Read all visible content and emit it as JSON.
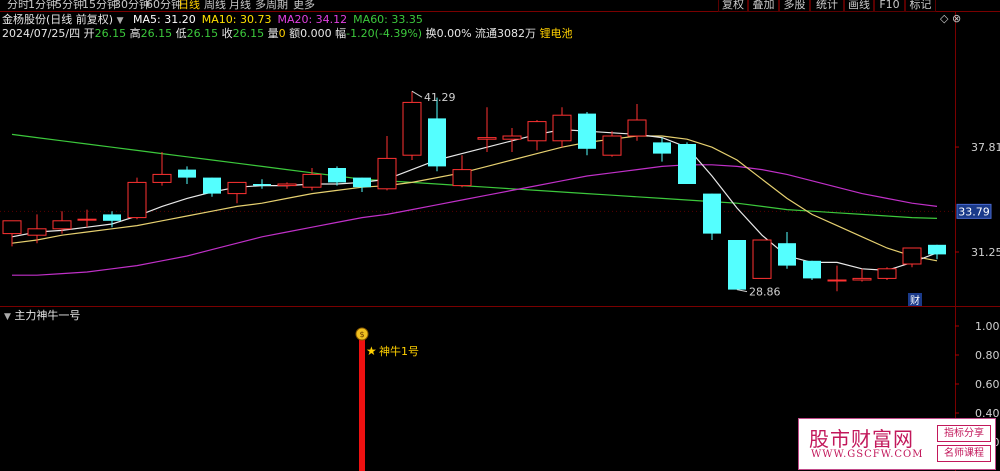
{
  "toolbar": {
    "periods": [
      "分时",
      "1分钟",
      "5分钟",
      "15分钟",
      "30分钟",
      "60分钟",
      "日线",
      "周线",
      "月线",
      "多周期",
      "更多"
    ],
    "selected_period": "日线",
    "right_buttons": [
      "复权",
      "叠加",
      "多股",
      "统计",
      "画线",
      "F10",
      "标记"
    ]
  },
  "header": {
    "stock": "金杨股份(日线 前复权)",
    "ma_items": [
      {
        "label": "MA5: 31.20",
        "color": "#ffffff"
      },
      {
        "label": "MA10: 30.73",
        "color": "#ffe000"
      },
      {
        "label": "MA20: 34.12",
        "color": "#e040e0"
      },
      {
        "label": "MA60: 33.35",
        "color": "#3cc83c"
      }
    ],
    "date": "2024/07/25/四",
    "open_label": "开",
    "open": "26.15",
    "high_label": "高",
    "high": "26.15",
    "low_label": "低",
    "low": "26.15",
    "close_label": "收",
    "close": "26.15",
    "vol_label": "量",
    "vol": "0",
    "amount_label": "额",
    "amount": "0.000",
    "chg_label": "幅",
    "chg": "-1.20(-4.39%)",
    "turnover": "换0.00%",
    "float_label": "流通",
    "float": "3082万",
    "concept": "锂电池"
  },
  "price_axis": [
    {
      "value": 37.81,
      "label": "37.81"
    },
    {
      "value": 31.25,
      "label": "31.25"
    }
  ],
  "current_price": {
    "value": 33.79,
    "label": "33.79"
  },
  "annotations": {
    "high_label": "41.29",
    "low_label": "28.86",
    "fin_badge": "财"
  },
  "indicator": {
    "name": "主力神牛一号",
    "signal_label": "神牛1号",
    "axis": [
      {
        "value": 1.0,
        "label": "1.00"
      },
      {
        "value": 0.8,
        "label": "0.80"
      },
      {
        "value": 0.6,
        "label": "0.60"
      },
      {
        "value": 0.4,
        "label": "0.40"
      },
      {
        "value": 0.2,
        "label": "0.20"
      }
    ],
    "signal_index": 14,
    "signal_value": 1.0
  },
  "watermark": {
    "main": "股市财富网",
    "url": "WWW.GSCFW.COM",
    "badge1": "指标分享",
    "badge2": "名师课程"
  },
  "chart_data": {
    "type": "candlestick",
    "y_range": [
      28.0,
      44.5
    ],
    "x_count": 38,
    "candles": [
      {
        "o": 32.4,
        "h": 33.1,
        "l": 31.6,
        "c": 33.2
      },
      {
        "o": 32.3,
        "h": 33.6,
        "l": 31.8,
        "c": 32.7
      },
      {
        "o": 32.7,
        "h": 33.8,
        "l": 32.4,
        "c": 33.2
      },
      {
        "o": 33.3,
        "h": 33.9,
        "l": 32.8,
        "c": 33.3
      },
      {
        "o": 33.6,
        "h": 33.8,
        "l": 32.8,
        "c": 33.2
      },
      {
        "o": 33.4,
        "h": 35.9,
        "l": 33.3,
        "c": 35.6
      },
      {
        "o": 35.6,
        "h": 37.5,
        "l": 35.4,
        "c": 36.1
      },
      {
        "o": 36.4,
        "h": 36.6,
        "l": 35.5,
        "c": 35.9
      },
      {
        "o": 35.9,
        "h": 35.9,
        "l": 34.7,
        "c": 34.9
      },
      {
        "o": 34.9,
        "h": 35.6,
        "l": 34.3,
        "c": 35.6
      },
      {
        "o": 35.5,
        "h": 35.8,
        "l": 35.2,
        "c": 35.4
      },
      {
        "o": 35.4,
        "h": 35.6,
        "l": 35.2,
        "c": 35.5
      },
      {
        "o": 35.3,
        "h": 36.5,
        "l": 35.1,
        "c": 36.1
      },
      {
        "o": 36.5,
        "h": 36.6,
        "l": 35.4,
        "c": 35.6
      },
      {
        "o": 35.9,
        "h": 35.9,
        "l": 35.0,
        "c": 35.3
      },
      {
        "o": 35.2,
        "h": 38.5,
        "l": 35.1,
        "c": 37.1
      },
      {
        "o": 37.3,
        "h": 41.3,
        "l": 37.0,
        "c": 40.6
      },
      {
        "o": 39.6,
        "h": 40.9,
        "l": 36.3,
        "c": 36.6
      },
      {
        "o": 35.4,
        "h": 37.3,
        "l": 35.3,
        "c": 36.4
      },
      {
        "o": 38.3,
        "h": 40.3,
        "l": 37.5,
        "c": 38.4
      },
      {
        "o": 38.3,
        "h": 39.0,
        "l": 37.5,
        "c": 38.5
      },
      {
        "o": 38.2,
        "h": 39.5,
        "l": 37.6,
        "c": 39.4
      },
      {
        "o": 38.2,
        "h": 40.3,
        "l": 37.8,
        "c": 39.8
      },
      {
        "o": 39.9,
        "h": 40.0,
        "l": 37.3,
        "c": 37.7
      },
      {
        "o": 37.3,
        "h": 38.8,
        "l": 37.2,
        "c": 38.5
      },
      {
        "o": 38.5,
        "h": 40.5,
        "l": 38.2,
        "c": 39.5
      },
      {
        "o": 38.1,
        "h": 38.4,
        "l": 36.9,
        "c": 37.4
      },
      {
        "o": 38.0,
        "h": 38.1,
        "l": 35.5,
        "c": 35.5
      },
      {
        "o": 34.9,
        "h": 34.9,
        "l": 32.0,
        "c": 32.4
      },
      {
        "o": 32.0,
        "h": 32.0,
        "l": 28.9,
        "c": 28.9
      },
      {
        "o": 29.6,
        "h": 32.0,
        "l": 29.6,
        "c": 32.0
      },
      {
        "o": 31.8,
        "h": 32.5,
        "l": 30.2,
        "c": 30.4
      },
      {
        "o": 30.7,
        "h": 30.7,
        "l": 29.5,
        "c": 29.6
      },
      {
        "o": 29.5,
        "h": 30.4,
        "l": 28.8,
        "c": 29.5
      },
      {
        "o": 29.5,
        "h": 30.2,
        "l": 29.4,
        "c": 29.6
      },
      {
        "o": 29.6,
        "h": 30.3,
        "l": 29.5,
        "c": 30.2
      },
      {
        "o": 30.5,
        "h": 30.9,
        "l": 30.3,
        "c": 31.5
      },
      {
        "o": 31.7,
        "h": 31.7,
        "l": 30.8,
        "c": 31.1
      }
    ],
    "ma5": [
      32.2,
      32.5,
      32.6,
      32.8,
      33.0,
      33.5,
      34.1,
      34.6,
      35.0,
      35.3,
      35.4,
      35.4,
      35.5,
      35.5,
      35.6,
      35.8,
      36.4,
      37.0,
      37.4,
      37.8,
      38.2,
      38.6,
      38.9,
      38.8,
      38.7,
      38.6,
      38.4,
      37.8,
      36.0,
      34.0,
      32.3,
      31.0,
      30.6,
      30.6,
      30.2,
      30.1,
      30.6,
      31.2
    ],
    "ma10": [
      31.8,
      32.0,
      32.3,
      32.5,
      32.7,
      32.9,
      33.2,
      33.5,
      33.8,
      34.1,
      34.3,
      34.6,
      34.9,
      35.1,
      35.3,
      35.4,
      35.6,
      35.9,
      36.2,
      36.6,
      37.0,
      37.4,
      37.8,
      38.1,
      38.3,
      38.5,
      38.5,
      38.3,
      37.8,
      37.0,
      35.8,
      34.6,
      33.6,
      32.9,
      32.2,
      31.5,
      31.0,
      30.7
    ],
    "ma20": [
      29.8,
      29.8,
      29.9,
      30.0,
      30.2,
      30.4,
      30.7,
      31.0,
      31.4,
      31.8,
      32.2,
      32.5,
      32.8,
      33.1,
      33.4,
      33.6,
      33.9,
      34.2,
      34.5,
      34.8,
      35.1,
      35.4,
      35.7,
      36.0,
      36.2,
      36.4,
      36.6,
      36.7,
      36.7,
      36.6,
      36.4,
      36.1,
      35.7,
      35.3,
      34.9,
      34.6,
      34.3,
      34.1
    ],
    "ma60": [
      38.6,
      38.4,
      38.2,
      38.0,
      37.8,
      37.6,
      37.4,
      37.2,
      37.0,
      36.8,
      36.6,
      36.4,
      36.2,
      36.0,
      35.8,
      35.7,
      35.6,
      35.5,
      35.4,
      35.3,
      35.2,
      35.1,
      35.0,
      34.9,
      34.8,
      34.7,
      34.6,
      34.5,
      34.4,
      34.3,
      34.1,
      33.9,
      33.8,
      33.7,
      33.6,
      33.5,
      33.4,
      33.35
    ]
  }
}
